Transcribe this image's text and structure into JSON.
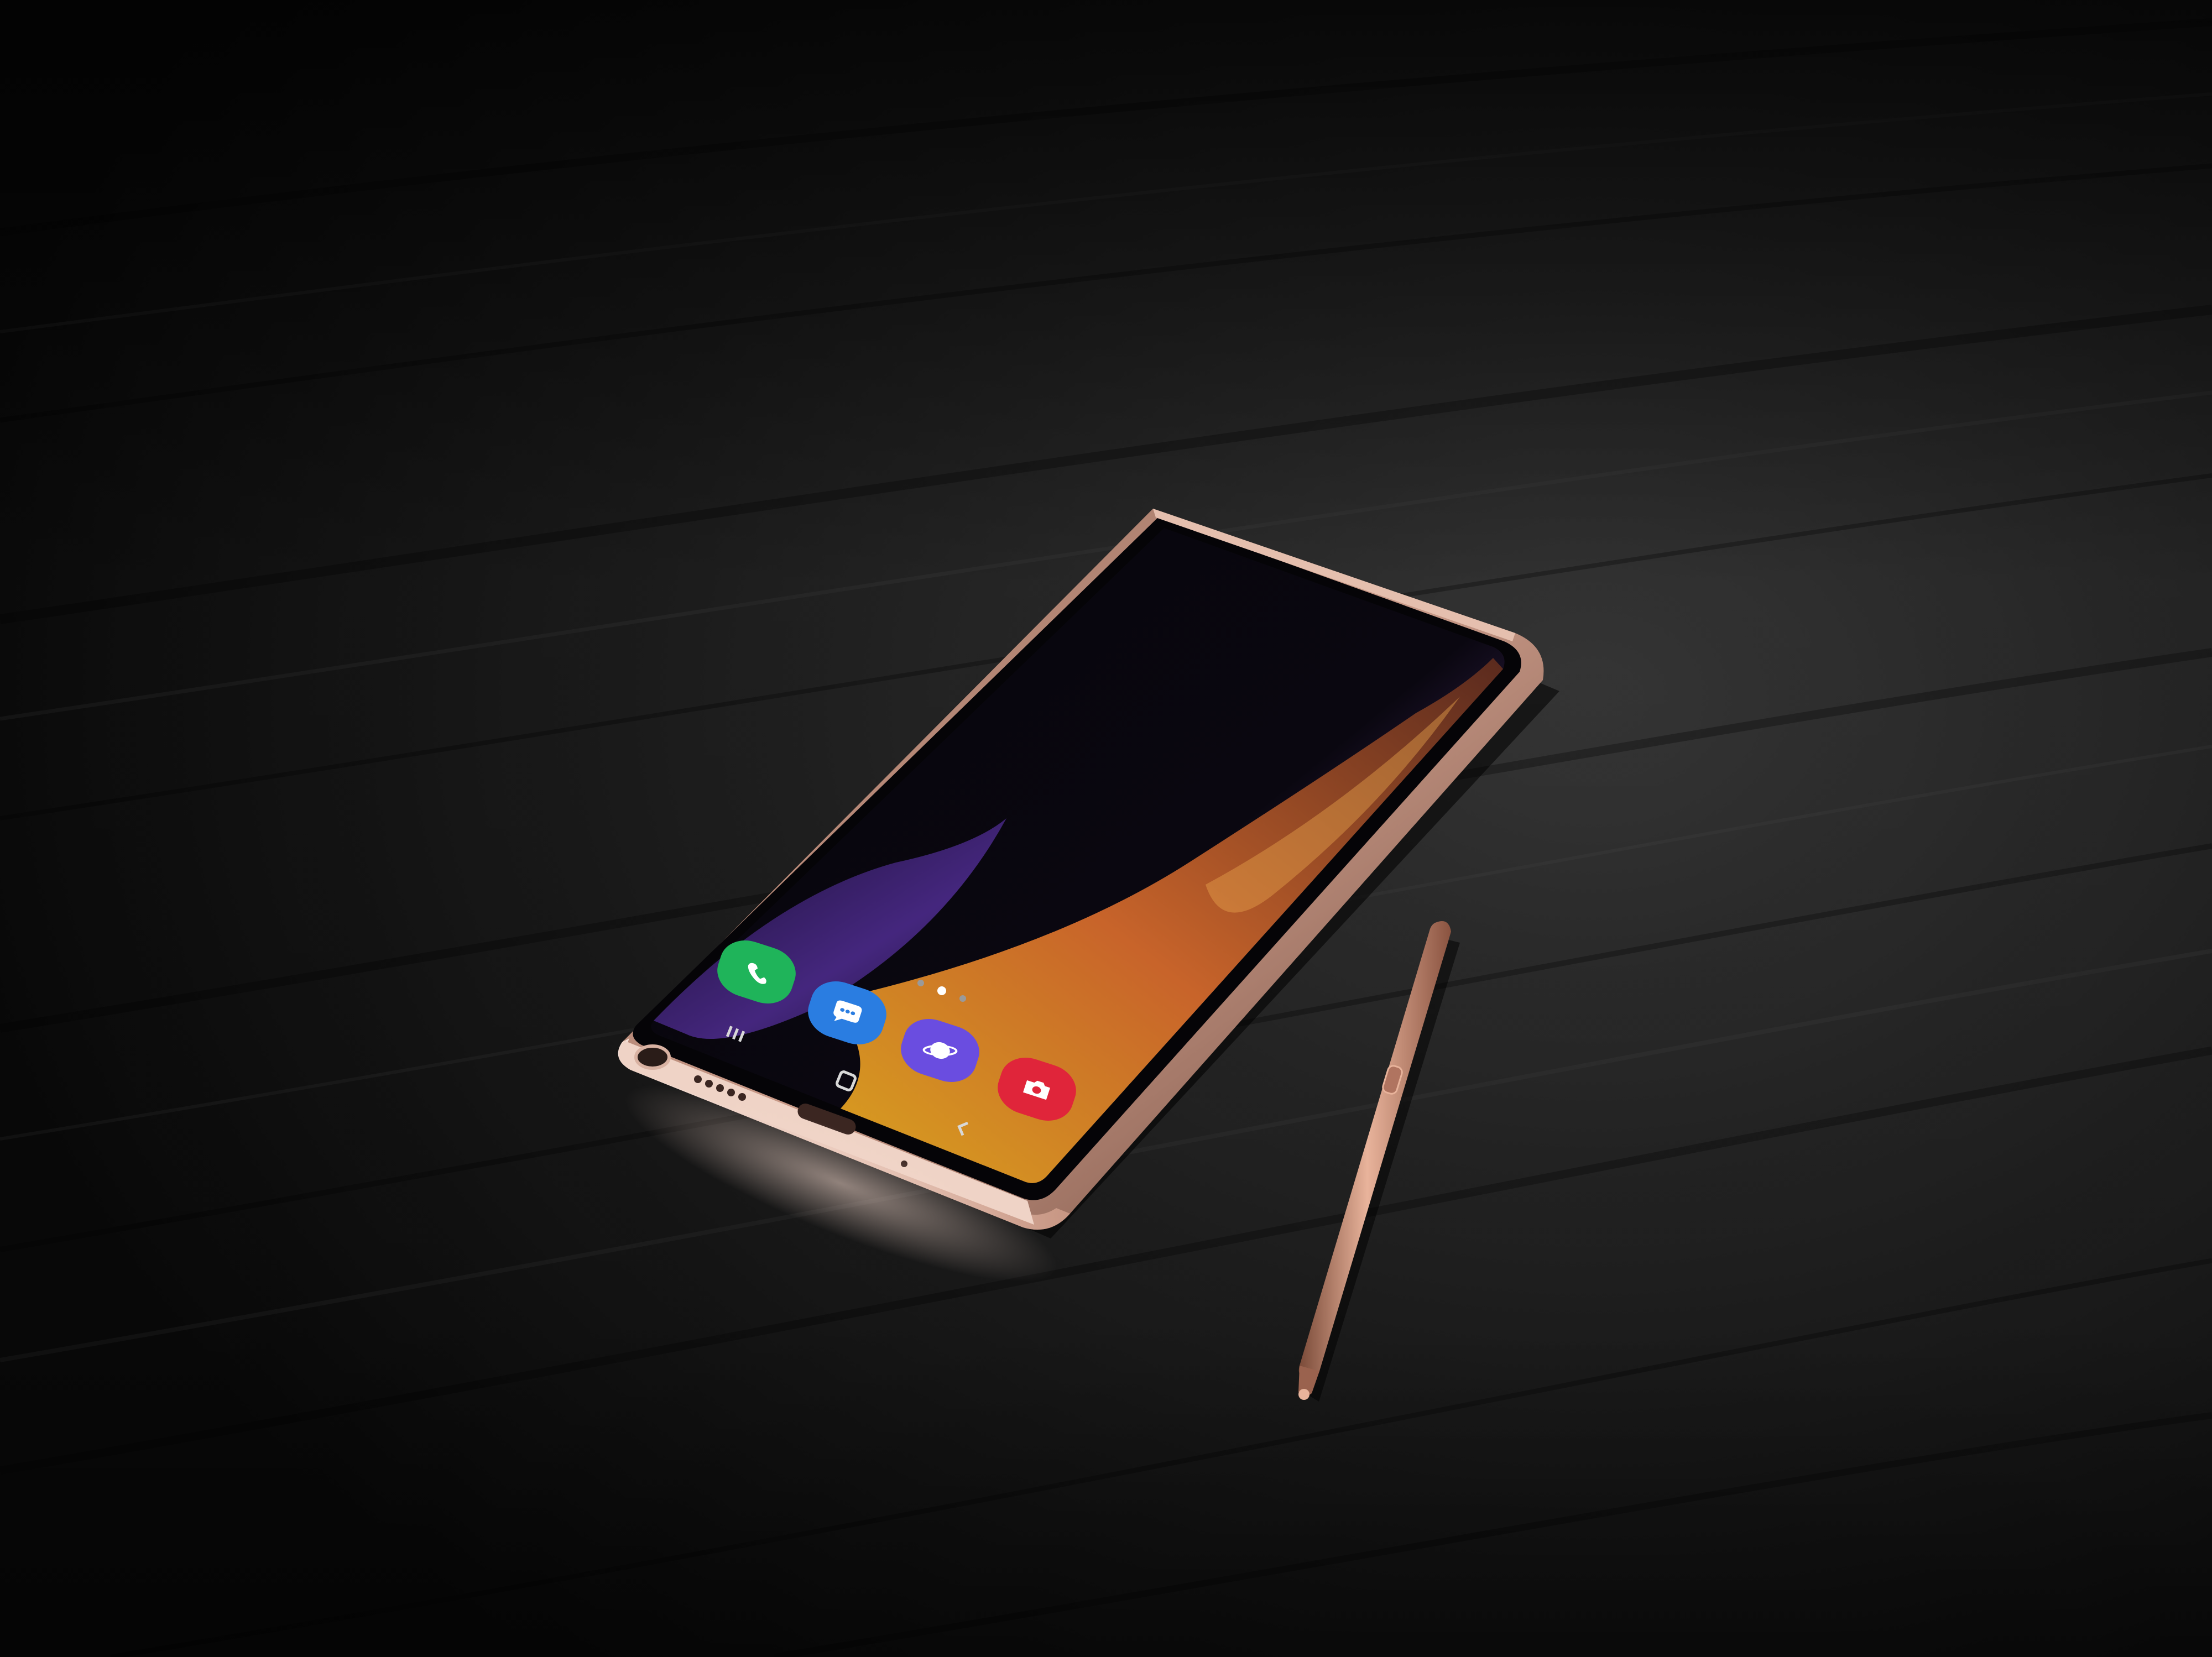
{
  "scene": {
    "subject": "smartphone-with-stylus-on-table",
    "colors": {
      "table_dark": "#0b0b0b",
      "table_light": "#3a3a3a",
      "phone_frame": "#c99a88",
      "phone_frame_highlight": "#f2d6cb",
      "screen_dark": "#07060c",
      "wallpaper_purple": "#3a1f6e",
      "wallpaper_orange": "#c8642a",
      "wallpaper_yellow": "#d9a21f",
      "stylus": "#c88a70",
      "stylus_highlight": "#e8b39b"
    }
  },
  "dock": {
    "apps": [
      {
        "icon": "phone-icon",
        "color": "#1fb45a"
      },
      {
        "icon": "messages-icon",
        "color": "#2a7de1"
      },
      {
        "icon": "internet-icon",
        "color": "#6a4de0"
      },
      {
        "icon": "camera-icon",
        "color": "#e0253a"
      }
    ],
    "page_dots": 3,
    "active_page": 1
  },
  "navbar": {
    "buttons": [
      "recents-icon",
      "home-icon",
      "back-icon"
    ]
  }
}
